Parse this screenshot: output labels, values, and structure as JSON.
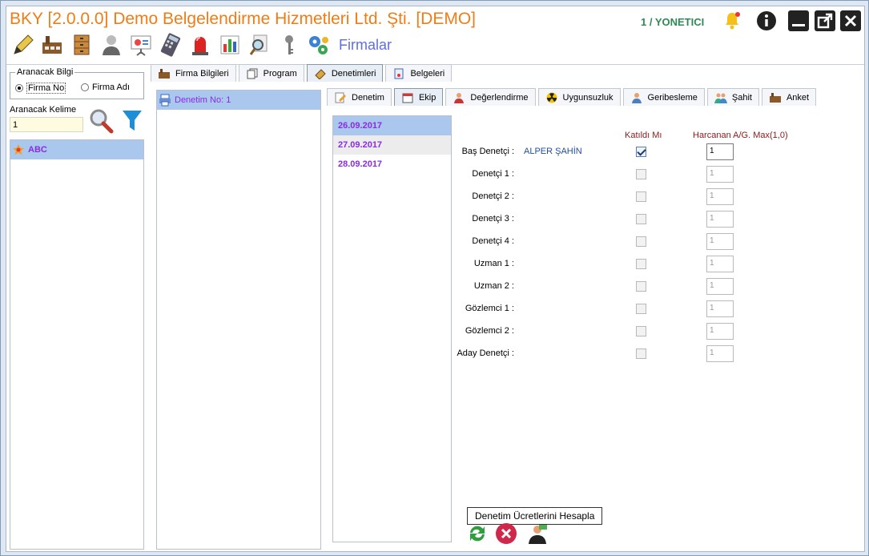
{
  "app": {
    "title": "BKY [2.0.0.0] Demo Belgelendirme Hizmetleri Ltd. Şti. [DEMO]",
    "user": "1 / YONETICI",
    "section": "Firmalar",
    "accent": "#ef7d17"
  },
  "header_icons": [
    "bell-icon",
    "info-icon",
    "minimize-icon",
    "popout-icon",
    "close-icon"
  ],
  "toolbar_icons": [
    "pen-icon",
    "factory-icon",
    "cabinet-icon",
    "user-icon",
    "presentation-icon",
    "calculator-icon",
    "alarm-light-icon",
    "bar-chart-icon",
    "magnifier-document-icon",
    "key-icon",
    "gears-icon"
  ],
  "search": {
    "group_label": "Aranacak Bilgi",
    "options": [
      "Firma No",
      "Firma Adı"
    ],
    "selected": "Firma No",
    "keyword_label": "Aranacak Kelime",
    "keyword_value": "1"
  },
  "firms": [
    {
      "name": "ABC",
      "icon": "star-badge-icon"
    }
  ],
  "main_tabs": [
    {
      "label": "Firma Bilgileri",
      "icon": "factory-icon"
    },
    {
      "label": "Program",
      "icon": "copy-icon"
    },
    {
      "label": "Denetimleri",
      "icon": "stamp-icon",
      "active": true
    },
    {
      "label": "Belgeleri",
      "icon": "certificate-icon"
    }
  ],
  "audits": [
    {
      "label": "Denetim No: 1",
      "icon": "printer-icon"
    }
  ],
  "sub_tabs": [
    {
      "label": "Denetim",
      "icon": "edit-icon"
    },
    {
      "label": "Ekip",
      "icon": "calendar-icon",
      "active": true
    },
    {
      "label": "Değerlendirme",
      "icon": "person-icon"
    },
    {
      "label": "Uygunsuzluk",
      "icon": "radiation-icon"
    },
    {
      "label": "Geribesleme",
      "icon": "person-icon"
    },
    {
      "label": "Şahit",
      "icon": "people-icon"
    },
    {
      "label": "Anket",
      "icon": "factory-icon"
    }
  ],
  "dates": [
    "26.09.2017",
    "27.09.2017",
    "28.09.2017"
  ],
  "team": {
    "col_attended": "Katıldı Mı",
    "col_hours": "Harcanan A/G. Max(1,0)",
    "rows": [
      {
        "role": "Baş Denetçi :",
        "name": "ALPER ŞAHİN",
        "attended": true,
        "hours": "1"
      },
      {
        "role": "Denetçi 1 :",
        "name": "",
        "attended": false,
        "hours": "1"
      },
      {
        "role": "Denetçi 2 :",
        "name": "",
        "attended": false,
        "hours": "1"
      },
      {
        "role": "Denetçi 3 :",
        "name": "",
        "attended": false,
        "hours": "1"
      },
      {
        "role": "Denetçi 4 :",
        "name": "",
        "attended": false,
        "hours": "1"
      },
      {
        "role": "Uzman 1 :",
        "name": "",
        "attended": false,
        "hours": "1"
      },
      {
        "role": "Uzman 2 :",
        "name": "",
        "attended": false,
        "hours": "1"
      },
      {
        "role": "Gözlemci 1 :",
        "name": "",
        "attended": false,
        "hours": "1"
      },
      {
        "role": "Gözlemci 2 :",
        "name": "",
        "attended": false,
        "hours": "1"
      },
      {
        "role": "Aday Denetçi :",
        "name": "",
        "attended": false,
        "hours": "1"
      }
    ]
  },
  "tooltip": "Denetim Ücretlerini Hesapla",
  "bottom_buttons": [
    "refresh-icon",
    "cancel-icon",
    "calculate-fee-icon"
  ]
}
